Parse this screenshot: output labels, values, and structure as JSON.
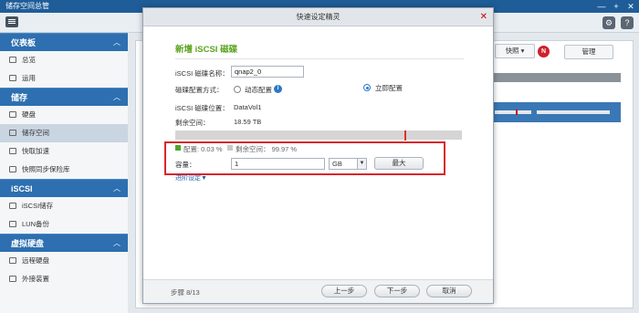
{
  "app": {
    "title": "储存空间总管"
  },
  "window_controls": [
    "—",
    "+",
    "✕"
  ],
  "toolbar": {
    "settings_icon": "gear-icon",
    "help_icon": "question-icon"
  },
  "sidebar": {
    "sections": [
      {
        "title": "仪表板",
        "items": [
          "总览",
          "运用"
        ]
      },
      {
        "title": "储存",
        "items": [
          "硬盘",
          "储存空间",
          "快取加速",
          "快照同步保险库"
        ]
      },
      {
        "title": "iSCSI",
        "items": [
          "iSCSI储存",
          "LUN备份"
        ]
      },
      {
        "title": "虚拟硬盘",
        "items": [
          "远程硬盘",
          "外接装置"
        ]
      }
    ],
    "chevron": "^"
  },
  "main": {
    "quick_label": "快照 ▾",
    "badge": "N",
    "manage_label": "管理"
  },
  "wizard": {
    "title": "快速设定精灵",
    "close": "✕",
    "subtitle": "新增 iSCSI 磁碟",
    "name_label": "iSCSI 磁碟名称：",
    "name_value": "qnap2_0",
    "alloc_label": "磁碟配置方式：",
    "alloc_dynamic": "动态配置",
    "alloc_instant": "立即配置",
    "location_label": "iSCSI 磁碟位置：",
    "location_value": "DataVol1",
    "free_label": "剩余空间：",
    "free_value": "18.59 TB",
    "allocated_label": "配置: 0.03 %",
    "remaining_label": "剩余空间： 99.97 %",
    "capacity_label": "容量：",
    "capacity_value": "1",
    "unit_value": "GB",
    "max_label": "最大",
    "advanced_link": "进阶设定▼",
    "step": "步骤 8/13",
    "back": "上一步",
    "next": "下一步",
    "cancel": "取消"
  }
}
